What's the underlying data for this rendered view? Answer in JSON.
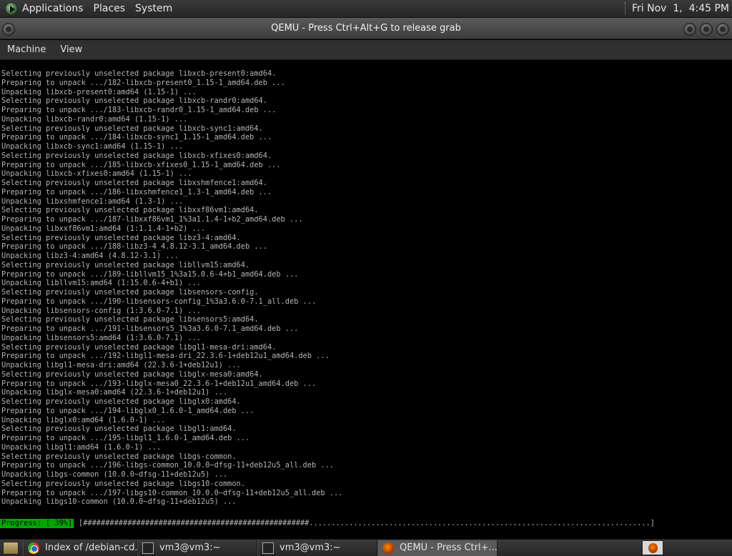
{
  "top_panel": {
    "menus": [
      "Applications",
      "Places",
      "System"
    ],
    "clock": "Fri Nov  1,  4:45 PM"
  },
  "window": {
    "title": "QEMU - Press Ctrl+Alt+G to release grab",
    "menu": [
      "Machine",
      "View"
    ]
  },
  "console": {
    "lines": [
      "Selecting previously unselected package libxcb-present0:amd64.",
      "Preparing to unpack .../182-libxcb-present0_1.15-1_amd64.deb ...",
      "Unpacking libxcb-present0:amd64 (1.15-1) ...",
      "Selecting previously unselected package libxcb-randr0:amd64.",
      "Preparing to unpack .../183-libxcb-randr0_1.15-1_amd64.deb ...",
      "Unpacking libxcb-randr0:amd64 (1.15-1) ...",
      "Selecting previously unselected package libxcb-sync1:amd64.",
      "Preparing to unpack .../184-libxcb-sync1_1.15-1_amd64.deb ...",
      "Unpacking libxcb-sync1:amd64 (1.15-1) ...",
      "Selecting previously unselected package libxcb-xfixes0:amd64.",
      "Preparing to unpack .../185-libxcb-xfixes0_1.15-1_amd64.deb ...",
      "Unpacking libxcb-xfixes0:amd64 (1.15-1) ...",
      "Selecting previously unselected package libxshmfence1:amd64.",
      "Preparing to unpack .../186-libxshmfence1_1.3-1_amd64.deb ...",
      "Unpacking libxshmfence1:amd64 (1.3-1) ...",
      "Selecting previously unselected package libxxf86vm1:amd64.",
      "Preparing to unpack .../187-libxxf86vm1_1%3a1.1.4-1+b2_amd64.deb ...",
      "Unpacking libxxf86vm1:amd64 (1:1.1.4-1+b2) ...",
      "Selecting previously unselected package libz3-4:amd64.",
      "Preparing to unpack .../188-libz3-4_4.8.12-3.1_amd64.deb ...",
      "Unpacking libz3-4:amd64 (4.8.12-3.1) ...",
      "Selecting previously unselected package libllvm15:amd64.",
      "Preparing to unpack .../189-libllvm15_1%3a15.0.6-4+b1_amd64.deb ...",
      "Unpacking libllvm15:amd64 (1:15.0.6-4+b1) ...",
      "Selecting previously unselected package libsensors-config.",
      "Preparing to unpack .../190-libsensors-config_1%3a3.6.0-7.1_all.deb ...",
      "Unpacking libsensors-config (1:3.6.0-7.1) ...",
      "Selecting previously unselected package libsensors5:amd64.",
      "Preparing to unpack .../191-libsensors5_1%3a3.6.0-7.1_amd64.deb ...",
      "Unpacking libsensors5:amd64 (1:3.6.0-7.1) ...",
      "Selecting previously unselected package libgl1-mesa-dri:amd64.",
      "Preparing to unpack .../192-libgl1-mesa-dri_22.3.6-1+deb12u1_amd64.deb ...",
      "Unpacking libgl1-mesa-dri:amd64 (22.3.6-1+deb12u1) ...",
      "Selecting previously unselected package libglx-mesa0:amd64.",
      "Preparing to unpack .../193-libglx-mesa0_22.3.6-1+deb12u1_amd64.deb ...",
      "Unpacking libglx-mesa0:amd64 (22.3.6-1+deb12u1) ...",
      "Selecting previously unselected package libglx0:amd64.",
      "Preparing to unpack .../194-libglx0_1.6.0-1_amd64.deb ...",
      "Unpacking libglx0:amd64 (1.6.0-1) ...",
      "Selecting previously unselected package libgl1:amd64.",
      "Preparing to unpack .../195-libgl1_1.6.0-1_amd64.deb ...",
      "Unpacking libgl1:amd64 (1.6.0-1) ...",
      "Selecting previously unselected package libgs-common.",
      "Preparing to unpack .../196-libgs-common_10.0.0~dfsg-11+deb12u5_all.deb ...",
      "Unpacking libgs-common (10.0.0~dfsg-11+deb12u5) ...",
      "Selecting previously unselected package libgs10-common.",
      "Preparing to unpack .../197-libgs10-common_10.0.0~dfsg-11+deb12u5_all.deb ...",
      "Unpacking libgs10-common (10.0.0~dfsg-11+deb12u5) ..."
    ],
    "progress_label": "Progress: [ 39%]",
    "progress_percent": 39,
    "progress_bar": "[###################################################.............................................................................]"
  },
  "taskbar": {
    "tasks": [
      {
        "label": "Index of /debian-cd...",
        "icon": "chrome-icon"
      },
      {
        "label": "vm3@vm3:~",
        "icon": "terminal-icon"
      },
      {
        "label": "vm3@vm3:~",
        "icon": "terminal-icon"
      },
      {
        "label": "QEMU - Press Ctrl+...",
        "icon": "qemu-icon"
      }
    ]
  }
}
